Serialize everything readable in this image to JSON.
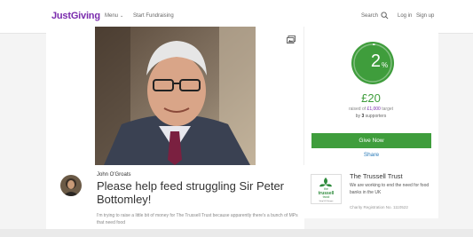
{
  "nav": {
    "logo": "JustGiving",
    "menu_label": "Menu",
    "menu_chevron": "⌄",
    "start_fundraising": "Start Fundraising",
    "search_label": "Search",
    "login": "Log in",
    "signup": "Sign up"
  },
  "donation": {
    "progress_percent": 2,
    "percent_number": "2",
    "percent_sign": "%",
    "raised": "£20",
    "raised_of_prefix": "raised of ",
    "target_amount": "£1,000",
    "target_suffix": " target",
    "supporters_prefix": "by ",
    "supporters_count": "3",
    "supporters_suffix": " supporters",
    "give_now": "Give Now",
    "share": "Share",
    "accent_color": "#3f9d3c"
  },
  "page": {
    "author": "John O'Groats",
    "title": "Please help feed struggling Sir Peter Bottomley!",
    "description": "I'm trying to raise a little bit of money for The Trussell Trust because apparently there's a bunch of MPs that need food"
  },
  "charity": {
    "name": "The Trussell Trust",
    "logo_line1": "the",
    "logo_line2": "trussell",
    "logo_line3": "trust",
    "logo_tagline": "Stop UK Hunger",
    "description": "We are working to end the need for food banks in the UK",
    "registration": "Charity Registration No. 1110522"
  },
  "icons": {
    "search": "search-icon",
    "gallery": "gallery-icon",
    "brand_color": "#7a2bad"
  }
}
